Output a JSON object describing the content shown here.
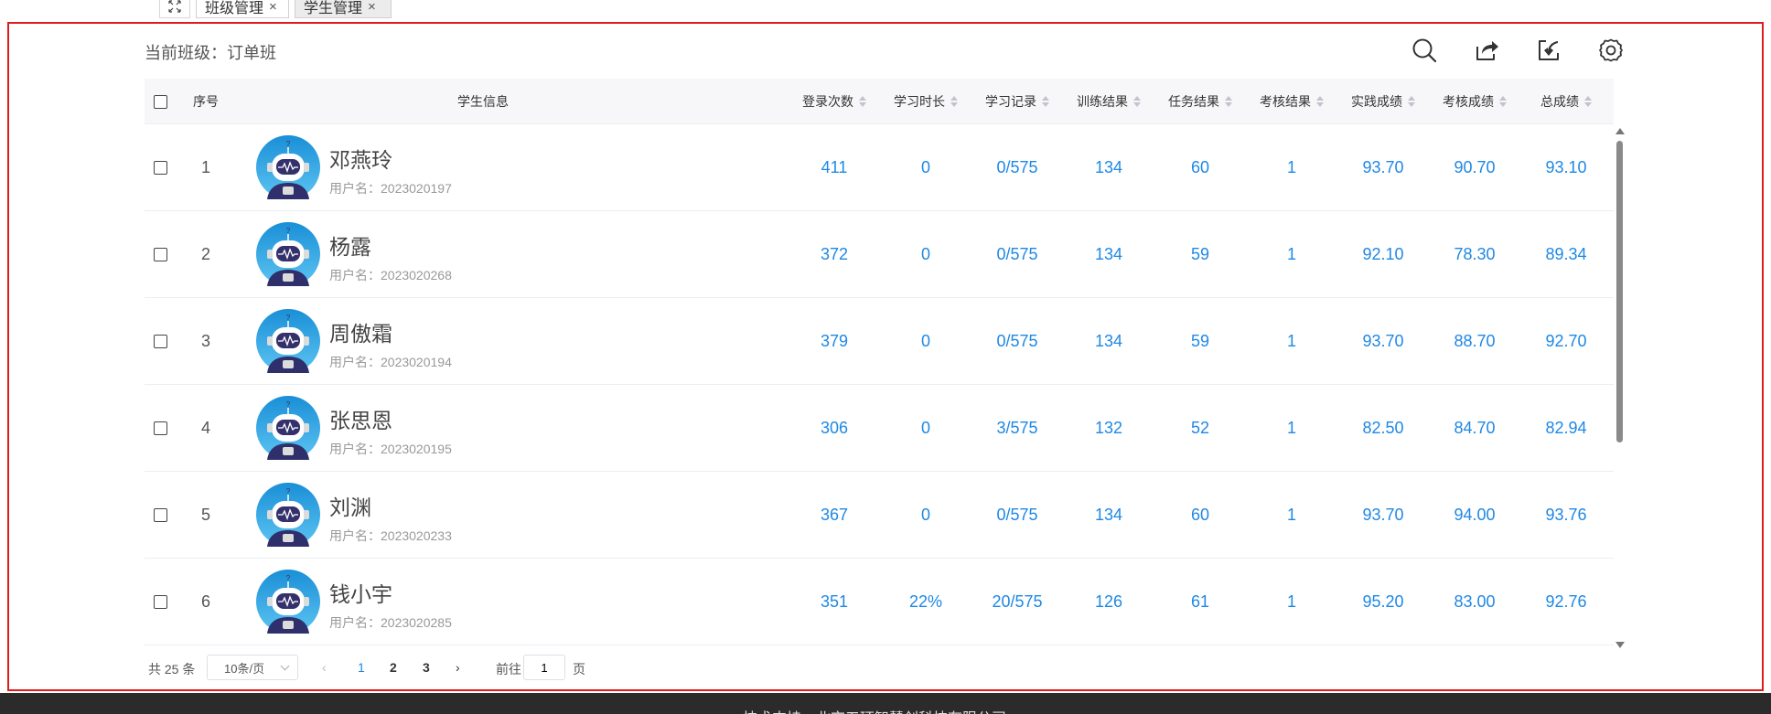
{
  "tabs": {
    "items": [
      {
        "label": "班级管理",
        "active": false
      },
      {
        "label": "学生管理",
        "active": true
      }
    ],
    "close_glyph": "×"
  },
  "class_label": "当前班级：订单班",
  "toolbar": {
    "icons": [
      "search-icon",
      "export-icon",
      "import-icon",
      "settings-icon"
    ]
  },
  "table": {
    "headers": {
      "index": "序号",
      "student": "学生信息",
      "logins": "登录次数",
      "study_time": "学习时长",
      "study_record": "学习记录",
      "training": "训练结果",
      "task": "任务结果",
      "exam_result": "考核结果",
      "practice_score": "实践成绩",
      "exam_score": "考核成绩",
      "total_score": "总成绩"
    },
    "rows": [
      {
        "index": "1",
        "name": "邓燕玲",
        "username": "用户名：2023020197",
        "logins": "411",
        "study_time": "0",
        "study_record": "0/575",
        "training": "134",
        "task": "60",
        "exam_result": "1",
        "practice_score": "93.70",
        "exam_score": "90.70",
        "total_score": "93.10"
      },
      {
        "index": "2",
        "name": "杨露",
        "username": "用户名：2023020268",
        "logins": "372",
        "study_time": "0",
        "study_record": "0/575",
        "training": "134",
        "task": "59",
        "exam_result": "1",
        "practice_score": "92.10",
        "exam_score": "78.30",
        "total_score": "89.34"
      },
      {
        "index": "3",
        "name": "周傲霜",
        "username": "用户名：2023020194",
        "logins": "379",
        "study_time": "0",
        "study_record": "0/575",
        "training": "134",
        "task": "59",
        "exam_result": "1",
        "practice_score": "93.70",
        "exam_score": "88.70",
        "total_score": "92.70"
      },
      {
        "index": "4",
        "name": "张思恩",
        "username": "用户名：2023020195",
        "logins": "306",
        "study_time": "0",
        "study_record": "3/575",
        "training": "132",
        "task": "52",
        "exam_result": "1",
        "practice_score": "82.50",
        "exam_score": "84.70",
        "total_score": "82.94"
      },
      {
        "index": "5",
        "name": "刘渊",
        "username": "用户名：2023020233",
        "logins": "367",
        "study_time": "0",
        "study_record": "0/575",
        "training": "134",
        "task": "60",
        "exam_result": "1",
        "practice_score": "93.70",
        "exam_score": "94.00",
        "total_score": "93.76"
      },
      {
        "index": "6",
        "name": "钱小宇",
        "username": "用户名：2023020285",
        "logins": "351",
        "study_time": "22%",
        "study_record": "20/575",
        "training": "126",
        "task": "61",
        "exam_result": "1",
        "practice_score": "95.20",
        "exam_score": "83.00",
        "total_score": "92.76"
      }
    ]
  },
  "pagination": {
    "total": "共 25 条",
    "page_size": "10条/页",
    "prev": "‹",
    "pages": [
      "1",
      "2",
      "3"
    ],
    "current": "1",
    "next": "›",
    "goto_label": "前往",
    "goto_value": "1",
    "page_unit": "页"
  },
  "footer": {
    "text": "技术支持：北京五环智慧创科技有限公司"
  },
  "colors": {
    "accent": "#1e88e5",
    "frame_border": "#e01b1b",
    "footer_bg": "#2b2b2b"
  }
}
